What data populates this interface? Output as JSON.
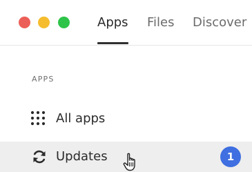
{
  "window": {
    "controls": [
      "close",
      "minimize",
      "zoom"
    ]
  },
  "tabs": [
    {
      "label": "Apps",
      "active": true
    },
    {
      "label": "Files",
      "active": false
    },
    {
      "label": "Discover",
      "active": false
    }
  ],
  "sidebar": {
    "section_heading": "APPS",
    "items": [
      {
        "label": "All apps",
        "icon": "grid-icon",
        "selected": false
      },
      {
        "label": "Updates",
        "icon": "refresh-icon",
        "selected": true,
        "badge": "1"
      }
    ]
  },
  "colors": {
    "close": "#ec5f58",
    "minimize": "#f5bd2e",
    "zoom": "#2ec449",
    "badge": "#3f6fe0",
    "selected_row": "#eeeeee"
  },
  "cursor": "hand-pointer-icon"
}
